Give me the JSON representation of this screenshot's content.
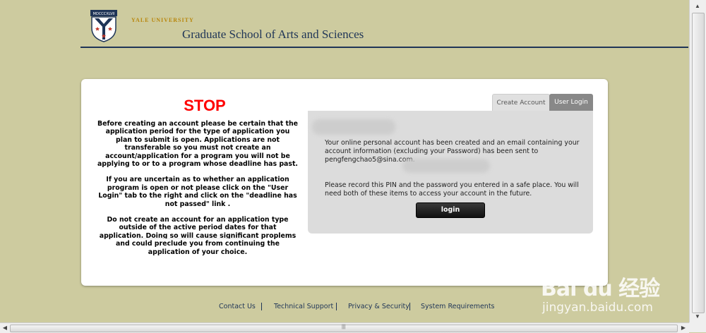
{
  "header": {
    "university": "YALE UNIVERSITY",
    "school": "Graduate School of Arts and Sciences",
    "shield_text": "MDCCCXLVII"
  },
  "notice": {
    "stop": "STOP",
    "paragraphs": [
      "Before creating an account please be certain that the application period for the type of application you plan to submit is open. Applications are not transferable so you must not create an account/application for a program you will not be applying to or to a program whose deadline has past.",
      "If you are uncertain as to whether an application program is open or not please click on the \"User Login\" tab to the right and click on the \"deadline has not passed\" link .",
      "Do not create an account for an application type outside of the active period dates for that application. Doing so will cause significant proplems and could preclude you from continuing the application of your choice."
    ]
  },
  "tabs": {
    "create_account": "Create Account",
    "user_login": "User Login"
  },
  "panel": {
    "message1": "Your online personal account has been created and an email containing your account information (excluding your Password) has been sent to pengfengchao5@sina.com.",
    "message2": "Please record this PIN and the password you entered in a safe place. You will need both of these items to access your account in the future.",
    "login_button": "login"
  },
  "footer": {
    "links": [
      "Contact Us",
      "Technical Support",
      "Privacy & Security",
      "System Requirements"
    ]
  },
  "watermark": {
    "brand": "Bai du 经验",
    "url": "jingyan.baidu.com"
  },
  "colors": {
    "background": "#cdcb9f",
    "navy": "#1f3557",
    "stop_red": "#ff0000",
    "gold": "#b8860b"
  }
}
